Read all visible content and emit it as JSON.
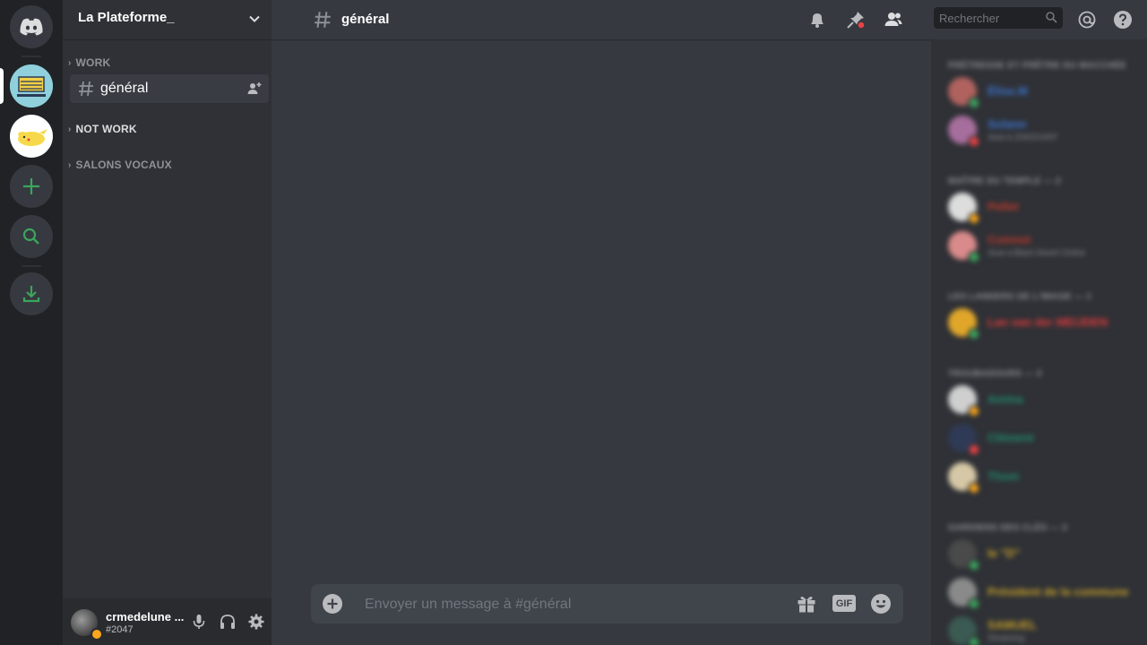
{
  "server": {
    "name": "La Plateforme_"
  },
  "categories": [
    {
      "label": "WORK"
    },
    {
      "label": "NOT WORK"
    },
    {
      "label": "SALONS VOCAUX"
    }
  ],
  "active_channel": {
    "name": "général"
  },
  "user": {
    "name": "crmedelune ...",
    "tag": "#2047",
    "status_color": "#faa61a"
  },
  "search": {
    "placeholder": "Rechercher"
  },
  "composer": {
    "placeholder": "Envoyer un message à #général",
    "gif_label": "GIF"
  },
  "icons": {
    "rail": [
      "discord-logo-icon",
      "plus-icon",
      "search-icon",
      "download-icon"
    ],
    "header": [
      "bell-icon",
      "pin-icon",
      "members-icon",
      "mention-icon",
      "help-icon"
    ],
    "panel": [
      "microphone-icon",
      "headphones-icon",
      "gear-icon"
    ]
  },
  "colors": {
    "accent_green": "#3ba55c",
    "background": "#36393f",
    "sidebar": "#2f3136",
    "rail": "#202225",
    "notification_red": "#ed4245"
  },
  "member_list": {
    "groups": [
      {
        "role": "PRÉTRESSE ET PRÊTRE DU MACCHÉE",
        "members": [
          {
            "name": "Élise.M",
            "color": "#3c74d1",
            "status": "#3ba55c",
            "avatar": "#b0625f"
          },
          {
            "name": "Solann",
            "color": "#3c74d1",
            "status": "#ed4245",
            "avatar": "#a66e9c",
            "activity": "Joue à JOAOCANT"
          }
        ]
      },
      {
        "role": "MAÎTRE DU TEMPLE — 2",
        "members": [
          {
            "name": "Pellet",
            "color": "#c0392b",
            "status": "#faa61a",
            "avatar": "#dddddd"
          },
          {
            "name": "Coinnet",
            "color": "#c0392b",
            "status": "#3ba55c",
            "avatar": "#d98a8a",
            "activity": "Joue à Black Desert Online"
          }
        ]
      },
      {
        "role": "LES LANDERS DE L'IMAGE — 1",
        "members": [
          {
            "name": "Lan van der MEIJDEN",
            "color": "#e03b3b",
            "status": "#3ba55c",
            "avatar": "#e0a62a"
          }
        ]
      },
      {
        "role": "TROUBADOURS — 3",
        "members": [
          {
            "name": "Amina",
            "color": "#1f8b6f",
            "status": "#faa61a",
            "avatar": "#cfcfcf"
          },
          {
            "name": "Clément",
            "color": "#1f8b6f",
            "status": "#ed4245",
            "avatar": "#2f3a56"
          },
          {
            "name": "Thom",
            "color": "#1f8b6f",
            "status": "#faa61a",
            "avatar": "#d6c8a6"
          }
        ]
      },
      {
        "role": "GARDIENS DES CLÉS — 3",
        "members": [
          {
            "name": "le \"D\"",
            "color": "#c8a12a",
            "status": "#3ba55c",
            "avatar": "#4a4a4a"
          },
          {
            "name": "Président de la commune",
            "color": "#c8a12a",
            "status": "#3ba55c",
            "avatar": "#8a8a8a"
          },
          {
            "name": "SAMUEL",
            "color": "#c8a12a",
            "status": "#3ba55c",
            "avatar": "#3b5a52",
            "activity": "Streaming"
          }
        ]
      }
    ]
  }
}
